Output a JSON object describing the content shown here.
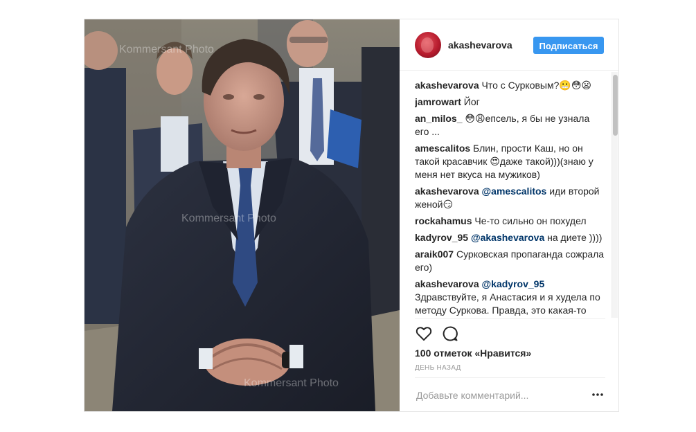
{
  "post": {
    "username": "akashevarova",
    "follow_label": "Подписаться",
    "photo_watermark": "Kommersant Photo",
    "comments": [
      {
        "user": "akashevarova",
        "text": " Что с Сурковым?😬😳😦"
      },
      {
        "user": "jamrowart",
        "text": " Йог"
      },
      {
        "user": "an_milos_",
        "text": " 😳😩епсель, я бы не узнала его ..."
      },
      {
        "user": "amescalitos",
        "text": " Блин, прости Каш, но он такой красавчик 😍даже такой)))(знаю у меня нет вкуса на мужиков)"
      },
      {
        "user": "akashevarova",
        "mention": " @amescalitos",
        "text": " иди второй женой😏"
      },
      {
        "user": "rockahamus",
        "text": " Че-то сильно он похудел"
      },
      {
        "user": "kadyrov_95",
        "mention": " @akashevarova",
        "text": " на диете ))))"
      },
      {
        "user": "araik007",
        "text": " Сурковская пропаганда сожрала его)"
      },
      {
        "user": "akashevarova",
        "mention": " @kadyrov_95",
        "text": " Здравствуйте, я Анастасия и я худела по методу Суркова. Правда, это какая-то антипропаганда для"
      }
    ],
    "icons": {
      "like": "heart-icon",
      "comment": "comment-icon",
      "more": "more-options-icon"
    },
    "likes_text": "100 отметок «Нравится»",
    "time_text": "ДЕНЬ НАЗАД",
    "add_comment_placeholder": "Добавьте комментарий...",
    "colors": {
      "follow_button": "#3897f0",
      "mention": "#003569",
      "muted": "#999999"
    }
  }
}
